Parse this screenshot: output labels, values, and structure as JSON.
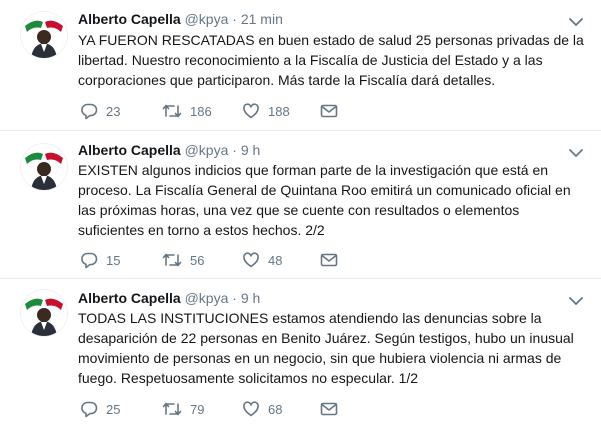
{
  "tweets": [
    {
      "author_name": "Alberto Capella",
      "handle": "@kpya",
      "separator": "·",
      "time": "21 min",
      "text": "YA FUERON RESCATADAS en buen estado de salud 25 personas privadas de la libertad. Nuestro reconocimiento a la Fiscalía de Justicia del Estado y a las corporaciones que participaron. Más tarde la Fiscalía dará detalles.",
      "replies": "23",
      "retweets": "186",
      "likes": "188"
    },
    {
      "author_name": "Alberto Capella",
      "handle": "@kpya",
      "separator": "·",
      "time": "9 h",
      "text": "EXISTEN algunos indicios que forman parte de la investigación que está en proceso. La Fiscalía General de Quintana Roo emitirá un comunicado oficial en las próximas horas, una vez que se cuente con resultados o elementos suficientes en torno a estos hechos. 2/2",
      "replies": "15",
      "retweets": "56",
      "likes": "48"
    },
    {
      "author_name": "Alberto Capella",
      "handle": "@kpya",
      "separator": "·",
      "time": "9 h",
      "text": "TODAS LAS INSTITUCIONES estamos atendiendo las denuncias sobre la desaparición de 22 personas en Benito Juárez. Según testigos, hubo un inusual movimiento de personas en un negocio, sin que hubiera violencia ni armas de fuego. Respetuosamente solicitamos no especular. 1/2",
      "replies": "25",
      "retweets": "79",
      "likes": "68"
    }
  ],
  "icons": {
    "reply": "reply-icon",
    "retweet": "retweet-icon",
    "like": "heart-icon",
    "dm": "envelope-icon",
    "more": "chevron-down-icon",
    "avatar": "avatar-flag-emblem"
  },
  "colors": {
    "text": "#14171a",
    "secondary": "#657786",
    "divider": "#e6ecf0",
    "flag_green": "#1e8a3c",
    "flag_red": "#c8102e"
  }
}
